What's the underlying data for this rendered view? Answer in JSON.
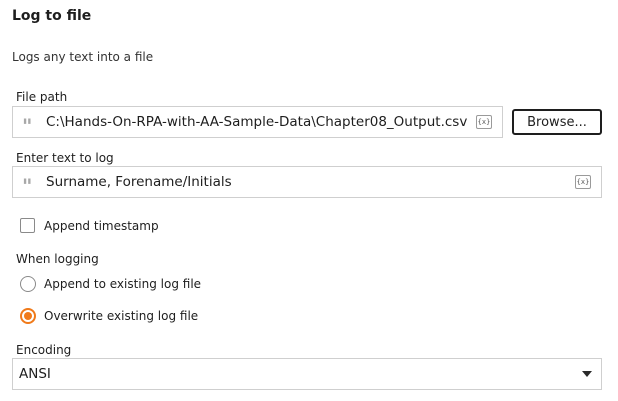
{
  "header": {
    "title": "Log to file",
    "description": "Logs any text into a file"
  },
  "file_path": {
    "label": "File path",
    "value": "C:\\Hands-On-RPA-with-AA-Sample-Data\\Chapter08_Output.csv",
    "variable_icon": "{x}",
    "browse_label": "Browse..."
  },
  "text_to_log": {
    "label": "Enter text to log",
    "value": "Surname, Forename/Initials",
    "variable_icon": "{x}"
  },
  "append_timestamp": {
    "label": "Append timestamp",
    "checked": false
  },
  "when_logging": {
    "label": "When logging",
    "options": [
      {
        "label": "Append to existing log file",
        "selected": false
      },
      {
        "label": "Overwrite existing log file",
        "selected": true
      }
    ]
  },
  "encoding": {
    "label": "Encoding",
    "selected": "ANSI"
  },
  "colors": {
    "accent": "#f07a1a",
    "border": "#cfcfcf",
    "text": "#1e1e1e"
  }
}
